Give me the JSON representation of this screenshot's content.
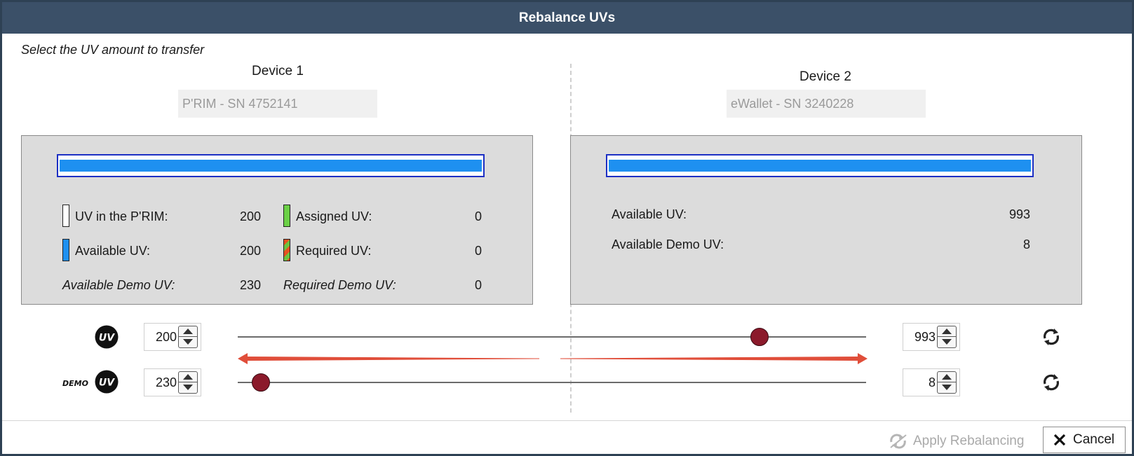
{
  "window": {
    "title": "Rebalance UVs"
  },
  "instruction": "Select the UV amount to transfer",
  "device1": {
    "title": "Device 1",
    "name": "P'RIM - SN 4752141",
    "stats": {
      "uv_in_prim_label": "UV in the P'RIM:",
      "uv_in_prim_value": "200",
      "available_uv_label": "Available UV:",
      "available_uv_value": "200",
      "available_demo_uv_label": "Available Demo UV:",
      "available_demo_uv_value": "230",
      "assigned_uv_label": "Assigned UV:",
      "assigned_uv_value": "0",
      "required_uv_label": "Required UV:",
      "required_uv_value": "0",
      "required_demo_uv_label": "Required Demo UV:",
      "required_demo_uv_value": "0"
    },
    "bar_fill_fraction": 1.0
  },
  "device2": {
    "title": "Device 2",
    "name": "eWallet - SN 3240228",
    "stats": {
      "available_uv_label": "Available UV:",
      "available_uv_value": "993",
      "available_demo_uv_label": "Available Demo UV:",
      "available_demo_uv_value": "8"
    },
    "bar_fill_fraction": 1.0
  },
  "uv_row": {
    "icon": "uv-badge-icon",
    "badge_text": "UV",
    "left_value": "200",
    "right_value": "993",
    "slider_fraction": 0.83
  },
  "demo_row": {
    "icon": "demo-uv-badge-icon",
    "badge_prefix": "DEMO",
    "badge_text": "UV",
    "left_value": "230",
    "right_value": "8",
    "slider_fraction": 0.037
  },
  "footer": {
    "apply_label": "Apply Rebalancing",
    "cancel_label": "Cancel"
  },
  "colors": {
    "titlebar": "#3b5068",
    "bar_blue": "#1e90f0",
    "bar_border": "#1c2fc4",
    "slider_thumb": "#8b1a2b",
    "arrow_red": "#e04e3a"
  }
}
